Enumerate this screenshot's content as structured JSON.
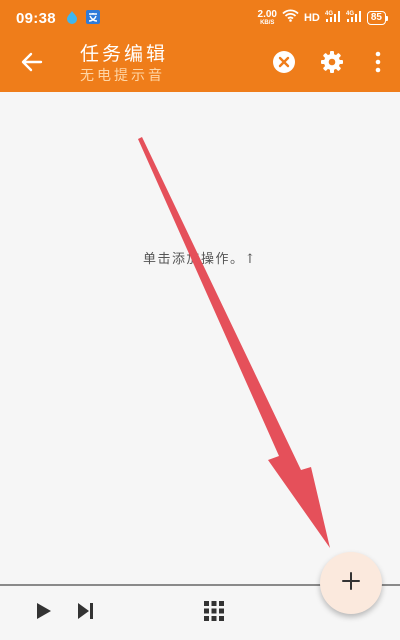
{
  "status_bar": {
    "time": "09:38",
    "net_speed_value": "2.00",
    "net_speed_unit": "KB/S",
    "hd_label": "HD",
    "battery_level": "85",
    "icons": [
      "shield-drop-icon",
      "translate-icon",
      "wifi-icon",
      "signal-4g-icon",
      "signal-4g-icon",
      "battery-icon"
    ]
  },
  "app_bar": {
    "title": "任务编辑",
    "subtitle": "无电提示音",
    "icons": [
      "arrow-left-icon",
      "close-circle-icon",
      "gear-icon",
      "more-vert-icon"
    ]
  },
  "content": {
    "empty_hint": "单击添加操作。↑"
  },
  "bottom_bar": {
    "icons": [
      "play-icon",
      "skip-next-icon",
      "grid-icon"
    ]
  },
  "fab": {
    "icon": "plus-icon"
  },
  "colors": {
    "primary": "#ef7d1a",
    "subtitle": "#ffd6a6",
    "background": "#f6f6f6",
    "fab_bg": "#fbe9dd",
    "arrow": "#e5505a"
  }
}
